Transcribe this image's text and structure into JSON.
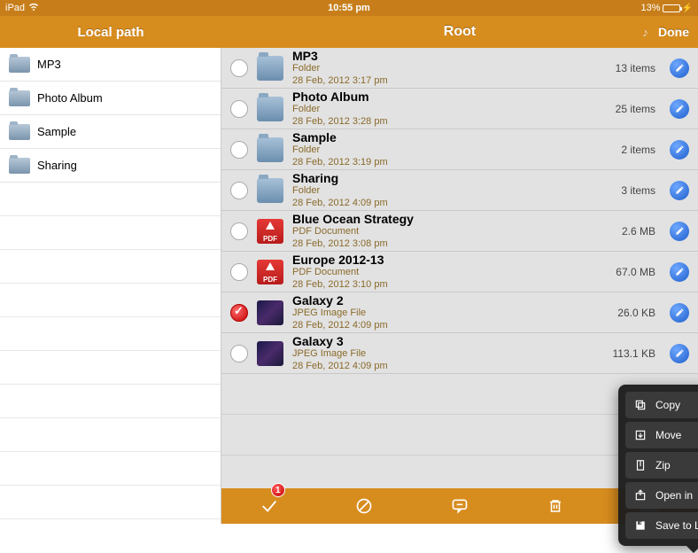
{
  "statusbar": {
    "device": "iPad",
    "time": "10:55 pm",
    "battery_text": "13%",
    "battery_pct": 13
  },
  "header": {
    "left_title": "Local path",
    "right_title": "Root",
    "done": "Done"
  },
  "sidebar": {
    "items": [
      {
        "label": "MP3"
      },
      {
        "label": "Photo Album"
      },
      {
        "label": "Sample"
      },
      {
        "label": "Sharing"
      }
    ]
  },
  "files": [
    {
      "name": "MP3",
      "type": "Folder",
      "date": "28 Feb, 2012 3:17 pm",
      "meta": "13 items",
      "checked": false,
      "kind": "folder"
    },
    {
      "name": "Photo Album",
      "type": "Folder",
      "date": "28 Feb, 2012 3:28 pm",
      "meta": "25 items",
      "checked": false,
      "kind": "folder"
    },
    {
      "name": "Sample",
      "type": "Folder",
      "date": "28 Feb, 2012 3:19 pm",
      "meta": "2 items",
      "checked": false,
      "kind": "folder"
    },
    {
      "name": "Sharing",
      "type": "Folder",
      "date": "28 Feb, 2012 4:09 pm",
      "meta": "3 items",
      "checked": false,
      "kind": "folder"
    },
    {
      "name": "Blue Ocean Strategy",
      "type": "PDF Document",
      "date": "28 Feb, 2012 3:08 pm",
      "meta": "2.6 MB",
      "checked": false,
      "kind": "pdf"
    },
    {
      "name": "Europe 2012-13",
      "type": "PDF Document",
      "date": "28 Feb, 2012 3:10 pm",
      "meta": "67.0 MB",
      "checked": false,
      "kind": "pdf"
    },
    {
      "name": "Galaxy 2",
      "type": "JPEG Image File",
      "date": "28 Feb, 2012 4:09 pm",
      "meta": "26.0 KB",
      "checked": true,
      "kind": "image"
    },
    {
      "name": "Galaxy 3",
      "type": "JPEG Image File",
      "date": "28 Feb, 2012 4:09 pm",
      "meta": "113.1 KB",
      "checked": false,
      "kind": "image"
    }
  ],
  "popover": {
    "items": [
      {
        "label": "Copy",
        "icon": "copy"
      },
      {
        "label": "Move",
        "icon": "move"
      },
      {
        "label": "Zip",
        "icon": "zip"
      },
      {
        "label": "Open in",
        "icon": "openin"
      },
      {
        "label": "Save to Library",
        "icon": "save"
      }
    ]
  },
  "bottombar": {
    "badge": "1"
  },
  "pdf_label": "PDF"
}
